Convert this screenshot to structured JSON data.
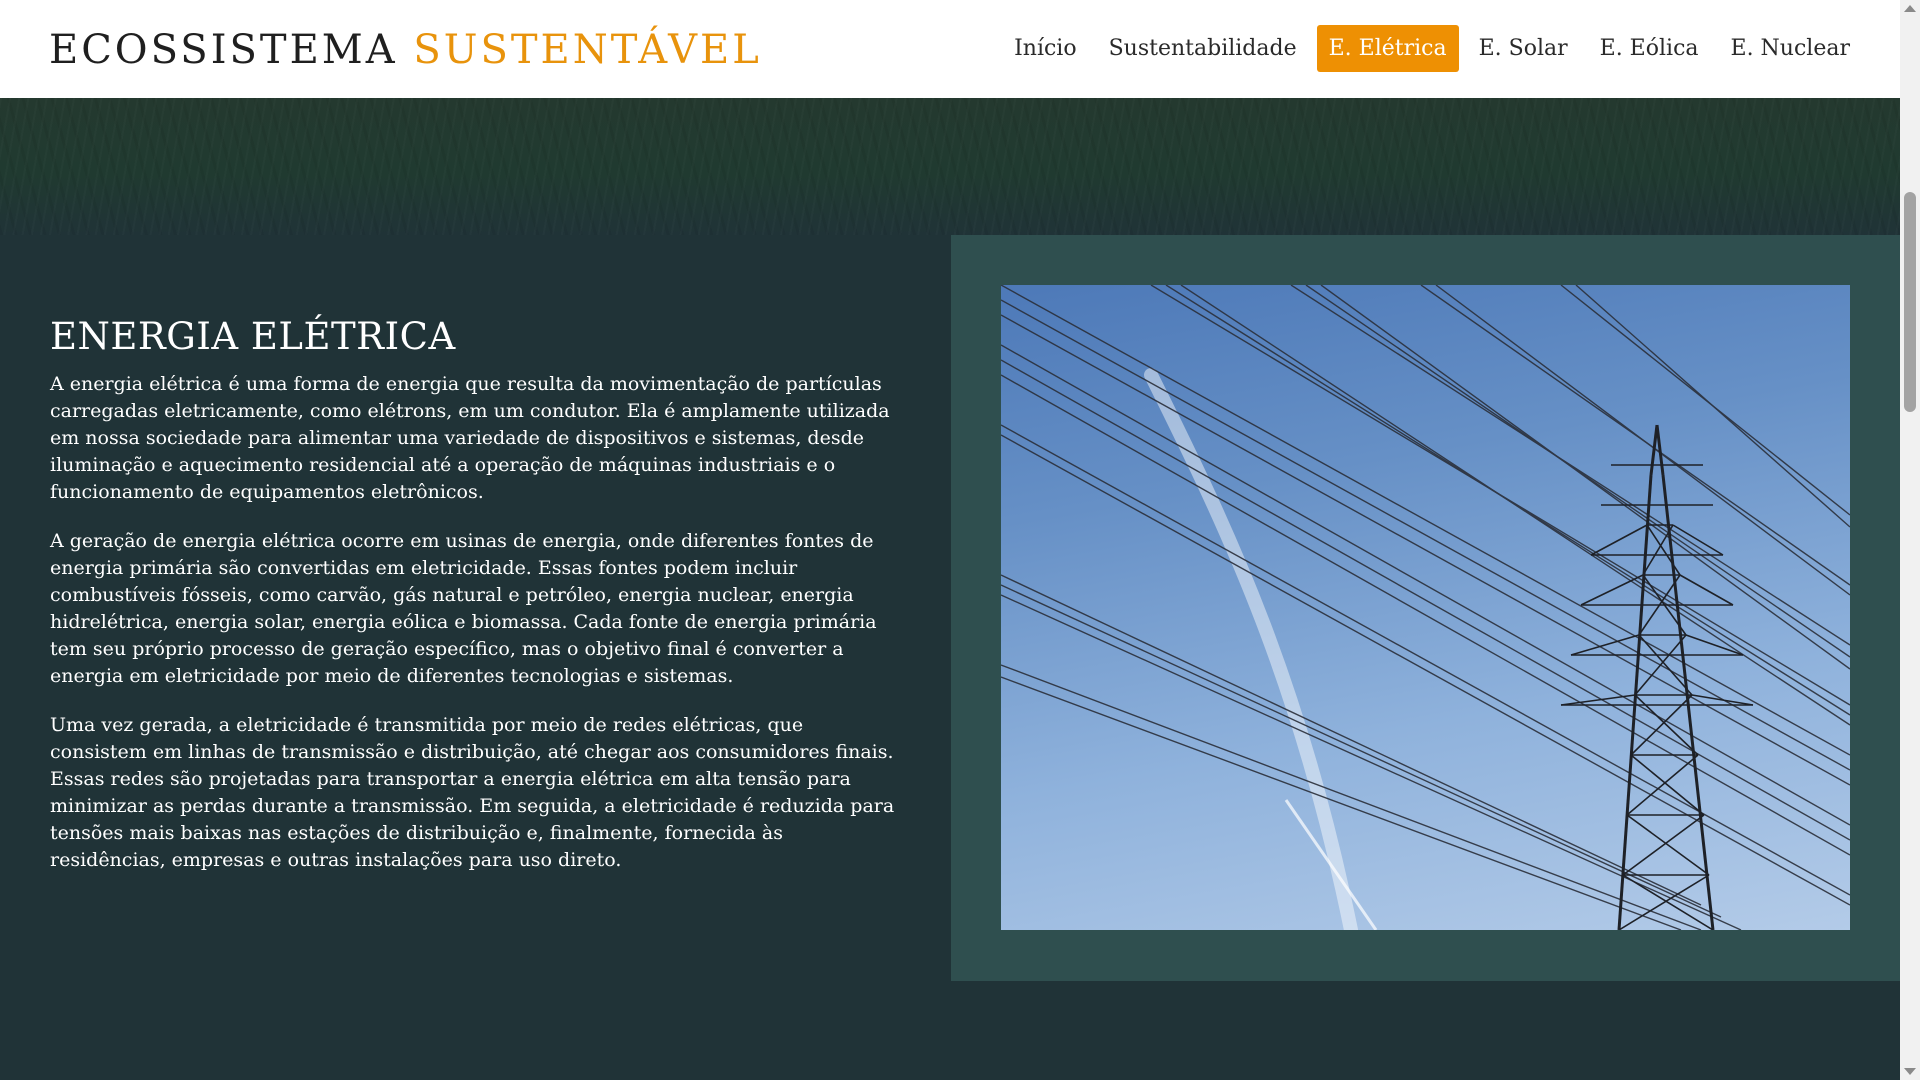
{
  "logo": {
    "primary": "ECOSSISTEMA",
    "accent": "SUSTENTÁVEL"
  },
  "nav": {
    "items": [
      {
        "label": "Início"
      },
      {
        "label": "Sustentabilidade"
      },
      {
        "label": "E. Elétrica",
        "active": true
      },
      {
        "label": "E. Solar"
      },
      {
        "label": "E. Eólica"
      },
      {
        "label": "E. Nuclear"
      }
    ]
  },
  "section": {
    "title": "ENERGIA ELÉTRICA",
    "paragraphs": [
      "A energia elétrica é uma forma de energia que resulta da movimentação de partículas carregadas eletricamente, como elétrons, em um condutor. Ela é amplamente utilizada em nossa sociedade para alimentar uma variedade de dispositivos e sistemas, desde iluminação e aquecimento residencial até a operação de máquinas industriais e o funcionamento de equipamentos eletrônicos.",
      "A geração de energia elétrica ocorre em usinas de energia, onde diferentes fontes de energia primária são convertidas em eletricidade. Essas fontes podem incluir combustíveis fósseis, como carvão, gás natural e petróleo, energia nuclear, energia hidrelétrica, energia solar, energia eólica e biomassa. Cada fonte de energia primária tem seu próprio processo de geração específico, mas o objetivo final é converter a energia em eletricidade por meio de diferentes tecnologias e sistemas.",
      "Uma vez gerada, a eletricidade é transmitida por meio de redes elétricas, que consistem em linhas de transmissão e distribuição, até chegar aos consumidores finais. Essas redes são projetadas para transportar a energia elétrica em alta tensão para minimizar as perdas durante a transmissão. Em seguida, a eletricidade é reduzida para tensões mais baixas nas estações de distribuição e, finalmente, fornecida às residências, empresas e outras instalações para uso direto."
    ]
  },
  "colors": {
    "accent": "#ee9003",
    "logo_accent": "#e8930c",
    "content_bg": "#203337",
    "image_frame_bg": "#2f4f4f",
    "header_bg": "#ffffff"
  },
  "icons": {
    "scroll_up": "chevron-up-icon",
    "scroll_down": "chevron-down-icon"
  }
}
